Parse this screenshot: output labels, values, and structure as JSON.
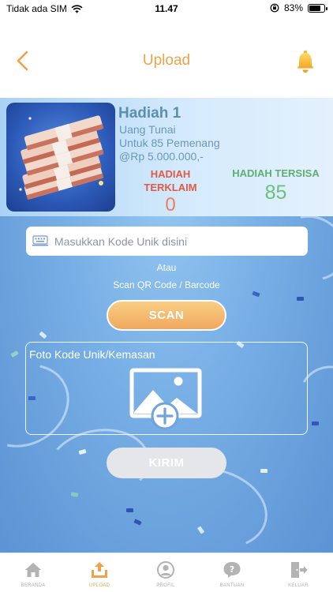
{
  "status_bar": {
    "carrier": "Tidak ada SIM",
    "time": "11.47",
    "battery": "83%",
    "battery_level": 0.83
  },
  "header": {
    "title": "Upload",
    "back_icon": "chevron-left-icon",
    "bell_icon": "bell-icon"
  },
  "prize": {
    "title": "Hadiah 1",
    "line1": "Uang Tunai",
    "line2": "Untuk 85 Pemenang",
    "line3": "@Rp 5.000.000,-",
    "claimed_label": "HADIAH TERKLAIM",
    "claimed_value": "0",
    "remaining_label": "HADIAH TERSISA",
    "remaining_value": "85"
  },
  "form": {
    "code_placeholder": "Masukkan Kode Unik disini",
    "or_text": "Atau",
    "scan_hint": "Scan QR Code / Barcode",
    "scan_button": "SCAN",
    "photo_label": "Foto Kode Unik/Kemasan",
    "send_button": "KIRIM"
  },
  "tabs": [
    {
      "label": "BERANDA",
      "icon": "home-icon",
      "active": false
    },
    {
      "label": "UPLOAD",
      "icon": "upload-icon",
      "active": true
    },
    {
      "label": "PROFIL",
      "icon": "profile-icon",
      "active": false
    },
    {
      "label": "BANTUAN",
      "icon": "help-icon",
      "active": false
    },
    {
      "label": "KELUAR",
      "icon": "logout-icon",
      "active": false
    }
  ],
  "colors": {
    "accent": "#eea24b",
    "claimed": "#e05a45",
    "remaining": "#6bc07c",
    "background_blue": "#79b0e6"
  }
}
